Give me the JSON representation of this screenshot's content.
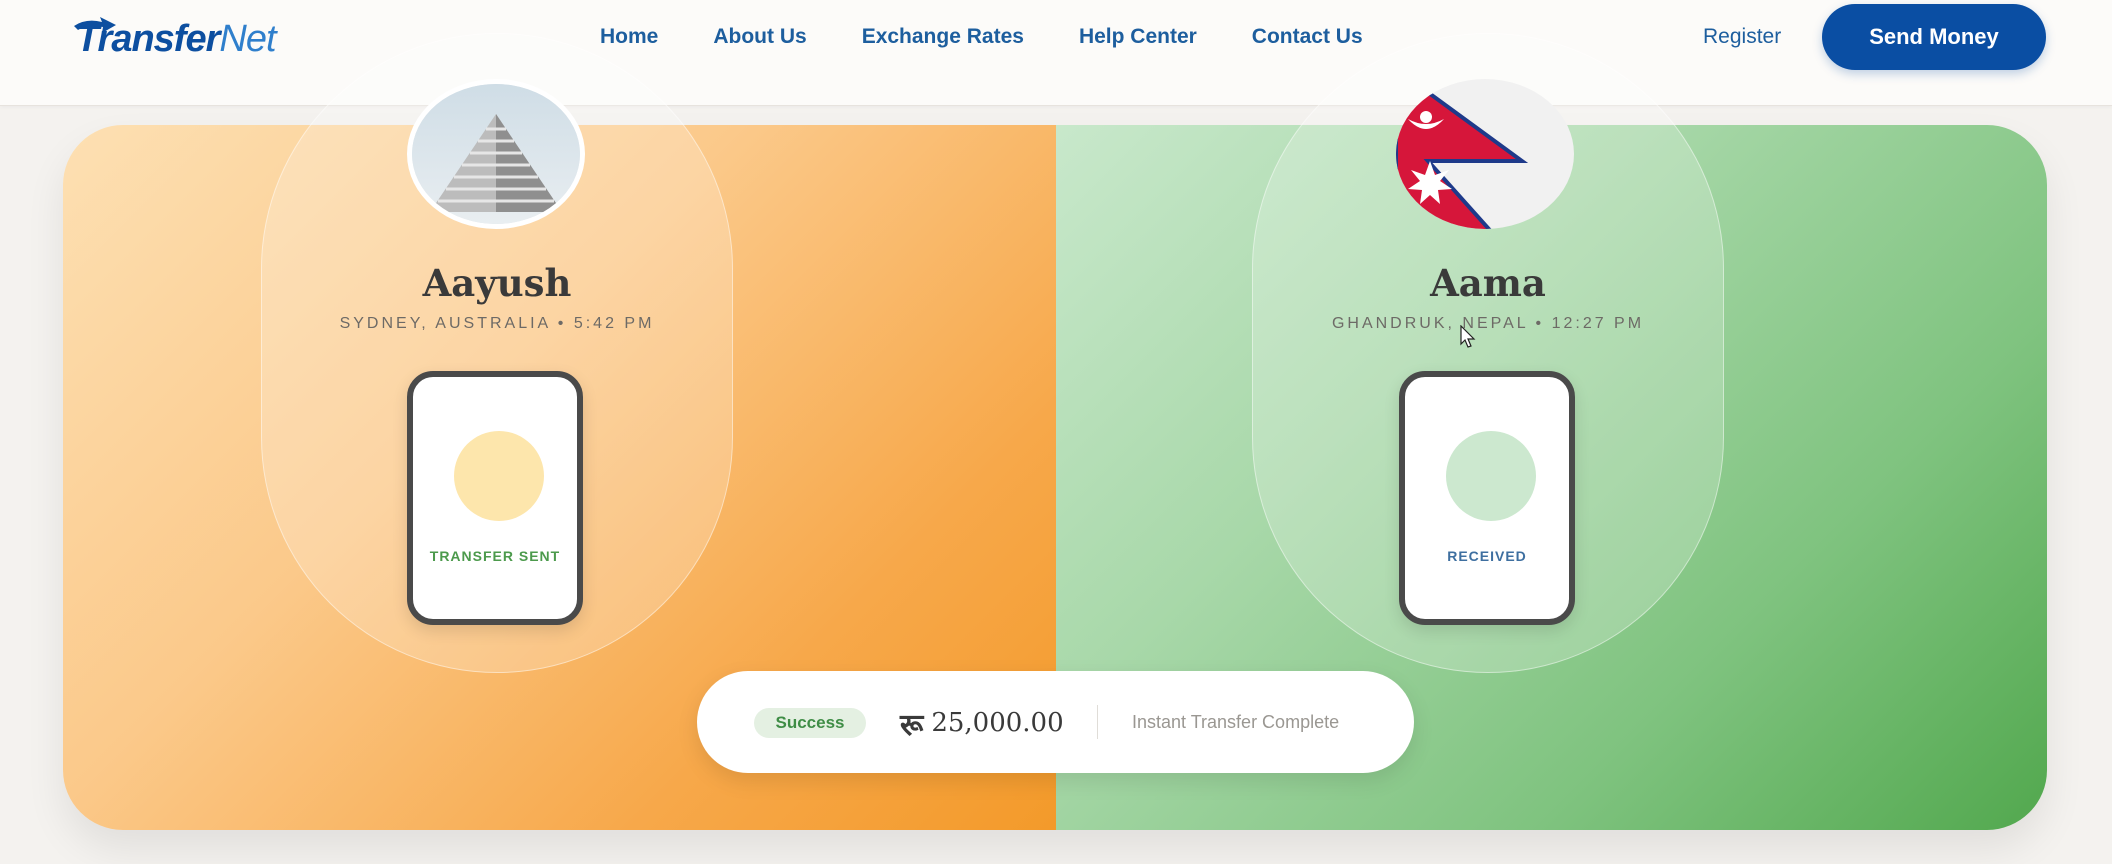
{
  "header": {
    "logo": {
      "part_a": "Transfer",
      "part_b": "Net",
      "icon": "arrow-logo-icon"
    },
    "nav": [
      {
        "label": "Home"
      },
      {
        "label": "About Us"
      },
      {
        "label": "Exchange Rates"
      },
      {
        "label": "Help Center"
      },
      {
        "label": "Contact Us"
      }
    ],
    "register_label": "Register",
    "send_money_label": "Send Money"
  },
  "colors": {
    "brand_blue": "#0a4ea3",
    "nav_blue": "#1d5e9e",
    "sender_orange": "#f7a84a",
    "receiver_green": "#7fc37f",
    "success_green": "#3f8d46"
  },
  "sender": {
    "name": "Aayush",
    "meta": "SYDNEY, AUSTRALIA • 5:42 PM",
    "avatar_icon": "building-photo",
    "phone_label": "TRANSFER SENT"
  },
  "receiver": {
    "name": "Aama",
    "meta": "GHANDRUK, NEPAL • 12:27 PM",
    "avatar_icon": "nepal-flag-icon",
    "phone_label": "RECEIVED"
  },
  "status": {
    "badge": "Success",
    "currency_symbol": "रू",
    "amount": "25,000.00",
    "message": "Instant Transfer Complete"
  }
}
